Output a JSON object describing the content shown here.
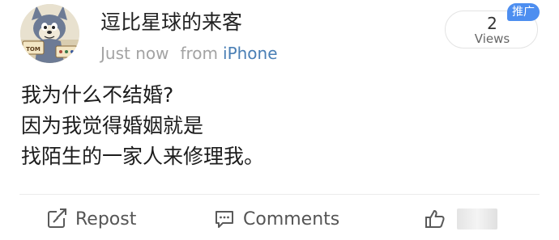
{
  "header": {
    "avatar": {
      "icon": "cartoon-cat-avatar",
      "caption": "TOM"
    },
    "username": "逗比星球的来客",
    "time": "Just now",
    "source_prefix": "from",
    "source": "iPhone"
  },
  "views": {
    "count": "2",
    "label": "Views",
    "badge": "推广"
  },
  "post": {
    "lines": [
      "我为什么不结婚?",
      "因为我觉得婚姻就是",
      "找陌生的一家人来修理我。"
    ]
  },
  "actions": {
    "repost": {
      "label": "Repost",
      "icon": "repost-icon"
    },
    "comments": {
      "label": "Comments",
      "icon": "comment-icon"
    },
    "like": {
      "icon": "thumbs-up-icon"
    }
  },
  "colors": {
    "link": "#4a7fb5",
    "badge": "#4d8ef0",
    "muted": "#a3a3a3"
  }
}
